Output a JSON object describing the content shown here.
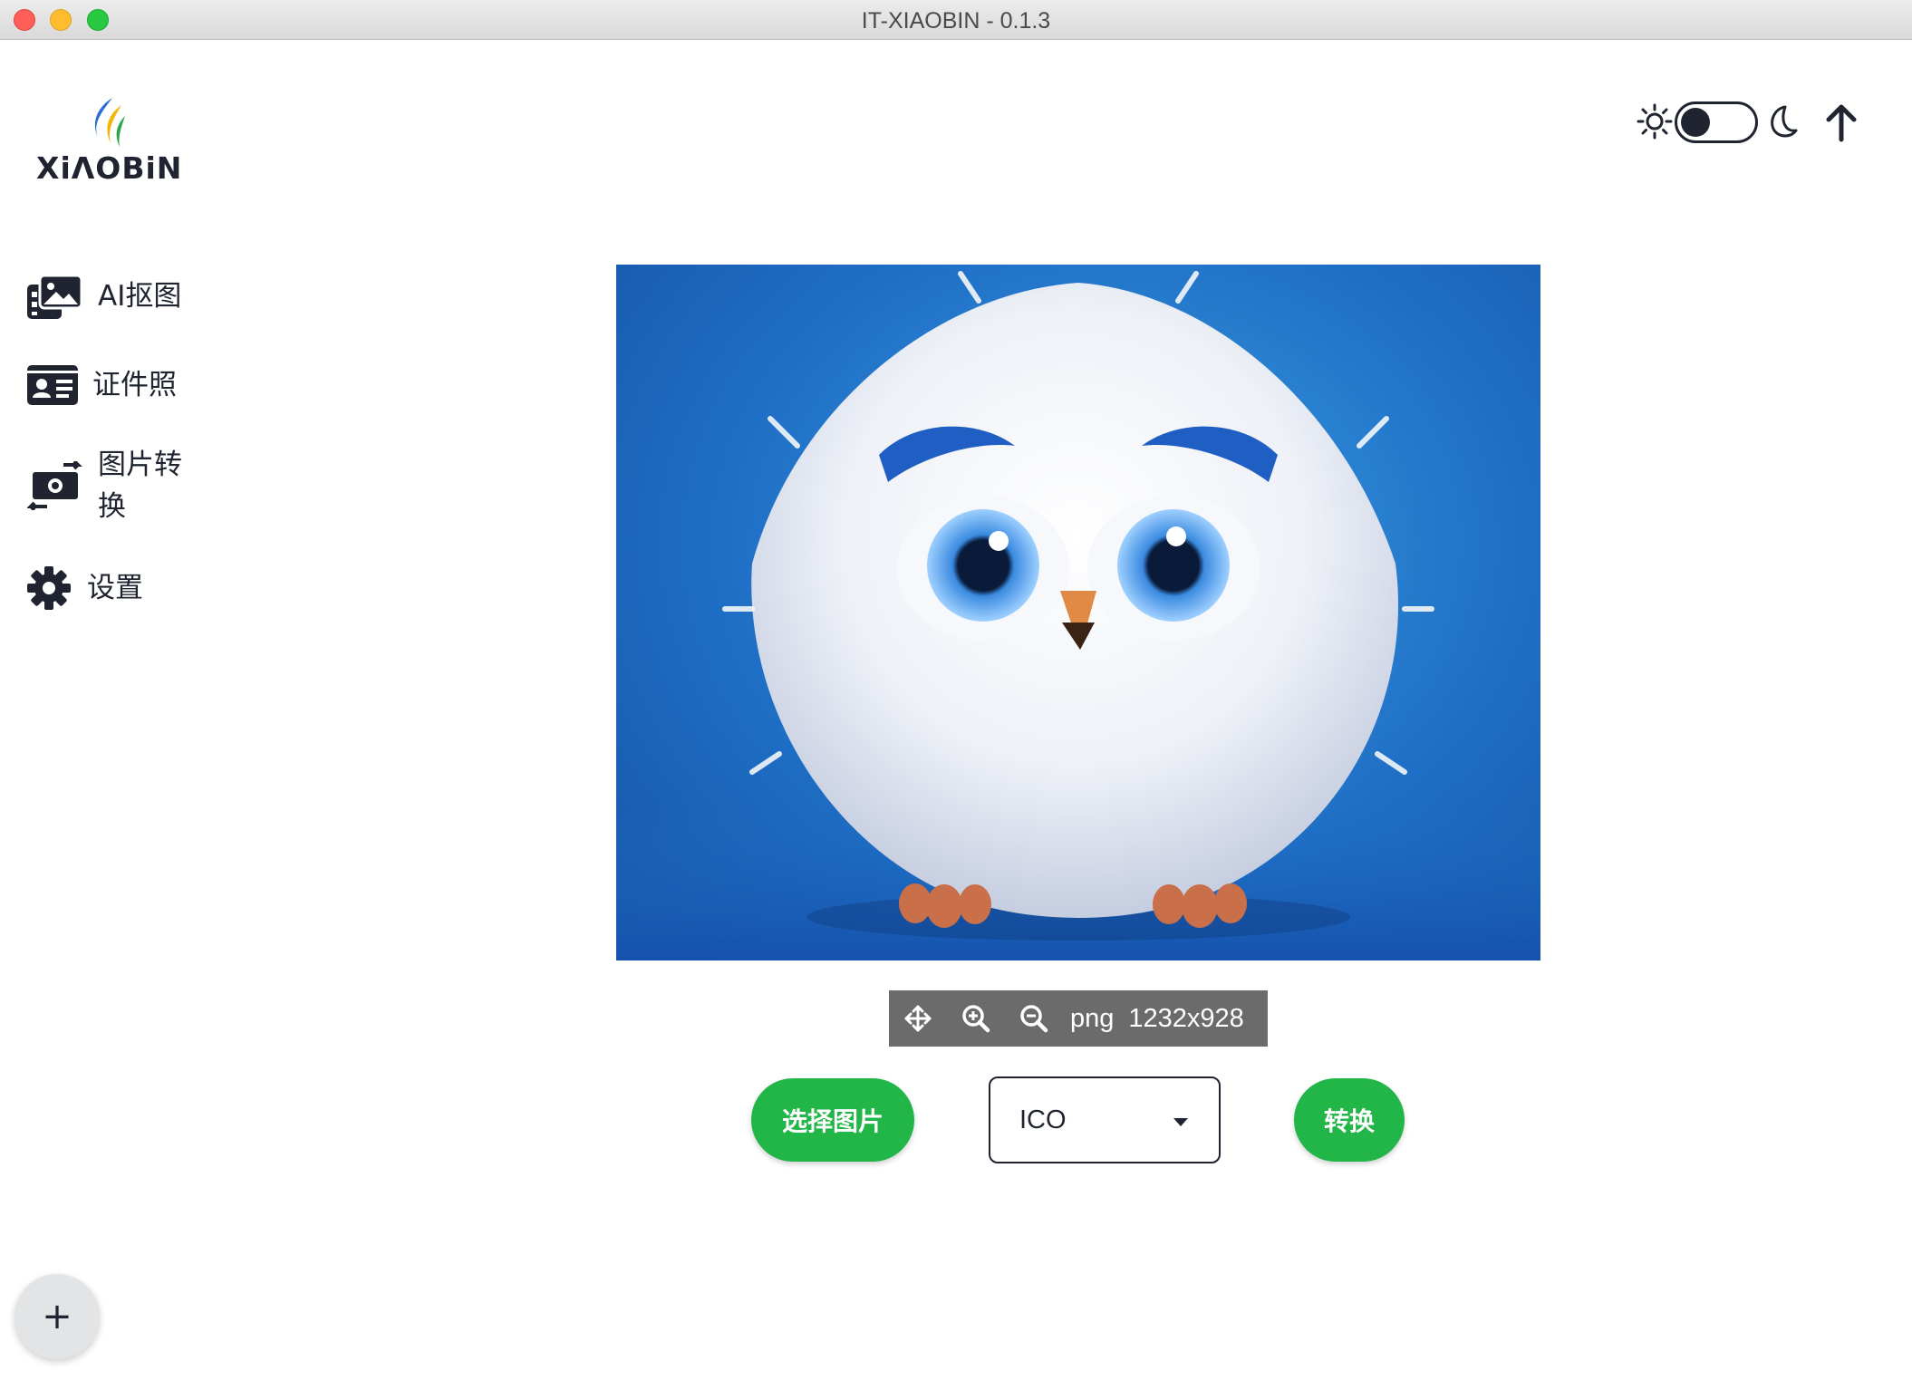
{
  "window": {
    "title": "IT-XIAOBIN - 0.1.3"
  },
  "brand": {
    "logo_text": "XiΛOBiN",
    "colors": {
      "blue": "#2a6fd6",
      "yellow": "#f2b705",
      "green": "#2aa84a"
    }
  },
  "sidebar": {
    "items": [
      {
        "label": "AI抠图",
        "icon": "image-gallery-icon"
      },
      {
        "label": "证件照",
        "icon": "id-card-icon"
      },
      {
        "label": "图片转换",
        "icon": "money-exchange-icon"
      },
      {
        "label": "设置",
        "icon": "gear-icon"
      }
    ]
  },
  "header": {
    "theme_toggle": {
      "state": "light",
      "icons": [
        "sun-icon",
        "moon-icon"
      ]
    },
    "upload_icon": "arrow-up-icon"
  },
  "preview": {
    "subject": "white fluffy owl with big blue eyes on blue background",
    "toolbar": {
      "icons": [
        "move-icon",
        "zoom-in-icon",
        "zoom-out-icon"
      ],
      "format": "png",
      "dimensions": "1232x928"
    }
  },
  "actions": {
    "select_image_label": "选择图片",
    "format_select": {
      "value": "ICO"
    },
    "convert_label": "转换"
  },
  "fab": {
    "label": "+"
  },
  "colors": {
    "accent_green": "#22b548",
    "dark": "#1f2430",
    "toolbar_bg": "#6b6b6b"
  }
}
